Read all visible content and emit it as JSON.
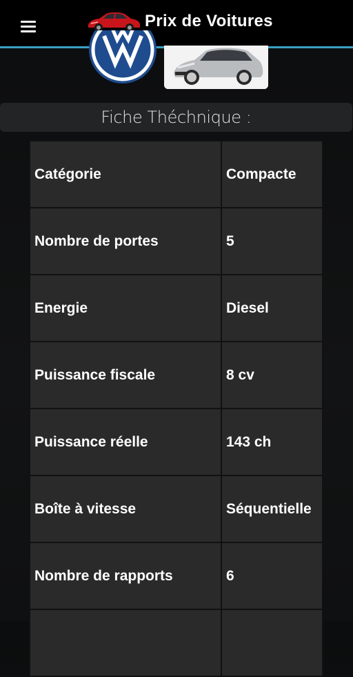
{
  "app": {
    "title": "Prix de Voitures"
  },
  "section": {
    "title": "Fiche Théchnique :"
  },
  "specs": [
    {
      "label": "Catégorie",
      "value": "Compacte"
    },
    {
      "label": "Nombre de portes",
      "value": "5"
    },
    {
      "label": "Energie",
      "value": "Diesel"
    },
    {
      "label": "Puissance fiscale",
      "value": "8 cv"
    },
    {
      "label": "Puissance réelle",
      "value": "143 ch"
    },
    {
      "label": "Boîte à vitesse",
      "value": "Séquentielle"
    },
    {
      "label": "Nombre de rapports",
      "value": "6"
    }
  ],
  "icons": {
    "menu": "hamburger-menu-icon",
    "app_logo": "red-car-logo",
    "brand_logo": "volkswagen-logo",
    "car_photo": "silver-hatchback-photo"
  },
  "colors": {
    "appbar_bg": "#000000",
    "appbar_border": "#39a0c4",
    "page_bg": "#121314",
    "section_bar_bg": "#232425",
    "cell_bg": "#2a2a2a",
    "car_red": "#c8151b",
    "vw_blue": "#1f4c8f"
  }
}
